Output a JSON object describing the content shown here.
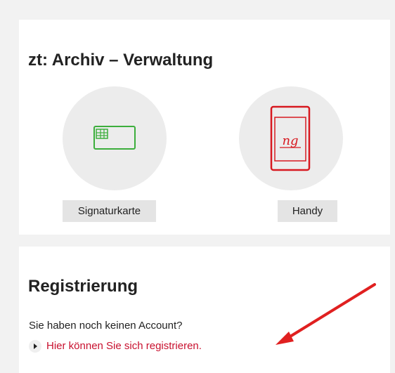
{
  "login_card": {
    "title": "zt: Archiv – Verwaltung",
    "methods": [
      {
        "icon": "signature-card-icon",
        "label": "Signaturkarte",
        "accent": "#3cae3c"
      },
      {
        "icon": "mobile-phone-icon",
        "label": "Handy",
        "accent": "#d71920"
      }
    ]
  },
  "registration_card": {
    "title": "Registrierung",
    "text": "Sie haben noch keinen Account?",
    "link": "Hier können Sie sich registrieren."
  },
  "colors": {
    "link": "#c8102e",
    "arrow": "#e02020",
    "page_background": "#f2f2f2",
    "card_background": "#ffffff",
    "button_background": "#e4e4e4"
  }
}
